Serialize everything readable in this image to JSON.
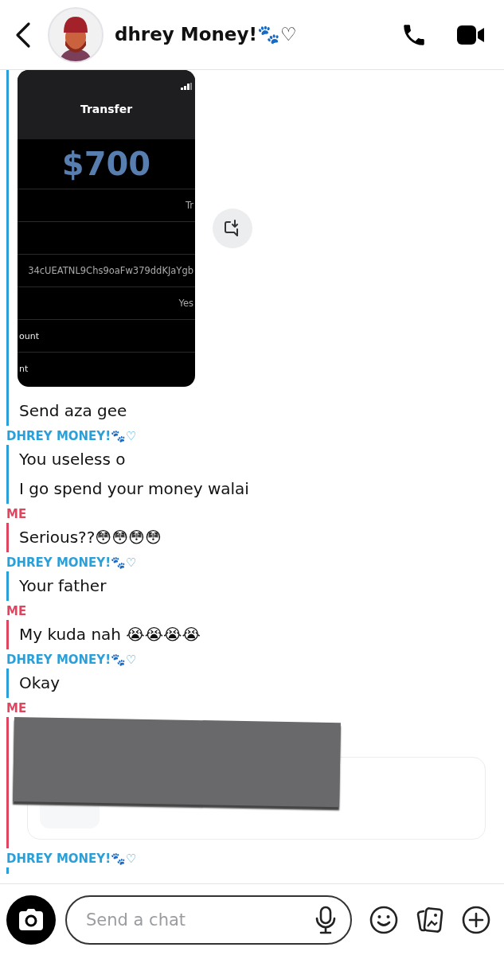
{
  "header": {
    "name": "dhrey Money!🐾♡"
  },
  "groups": [
    {
      "kind": "friend",
      "items": [
        {
          "kind": "image",
          "screen": {
            "title": "Transfer",
            "amount": "$700",
            "rows": [
              {
                "text": "Tr",
                "kind": "value"
              },
              {
                "kind": "empty"
              },
              {
                "text": "34cUEATNL9Chs9oaFw379ddKJaYgb",
                "kind": "value"
              },
              {
                "text": "Yes",
                "kind": "value"
              },
              {
                "text": "ount",
                "kind": "label"
              },
              {
                "text": "nt",
                "kind": "label"
              }
            ]
          }
        },
        {
          "kind": "text",
          "text": "Send aza gee"
        }
      ]
    },
    {
      "kind": "friend",
      "label": "DHREY MONEY!🐾♡",
      "items": [
        {
          "kind": "text",
          "text": "You useless o"
        },
        {
          "kind": "text",
          "text": "I go spend your money walai"
        }
      ]
    },
    {
      "kind": "me",
      "label": "ME",
      "items": [
        {
          "kind": "text",
          "text": "Serious??😳😳😳😳"
        }
      ]
    },
    {
      "kind": "friend",
      "label": "DHREY MONEY!🐾♡",
      "items": [
        {
          "kind": "text",
          "text": "Your father"
        }
      ]
    },
    {
      "kind": "me",
      "label": "ME",
      "items": [
        {
          "kind": "text",
          "text": "My kuda nah 😭😭😭😭"
        }
      ]
    },
    {
      "kind": "friend",
      "label": "DHREY MONEY!🐾♡",
      "items": [
        {
          "kind": "text",
          "text": "Okay"
        }
      ]
    },
    {
      "kind": "me",
      "label": "ME",
      "items": [
        {
          "kind": "redacted_card"
        }
      ]
    },
    {
      "kind": "friend",
      "label": "DHREY MONEY!🐾♡"
    }
  ],
  "composer": {
    "placeholder": "Send a chat"
  }
}
